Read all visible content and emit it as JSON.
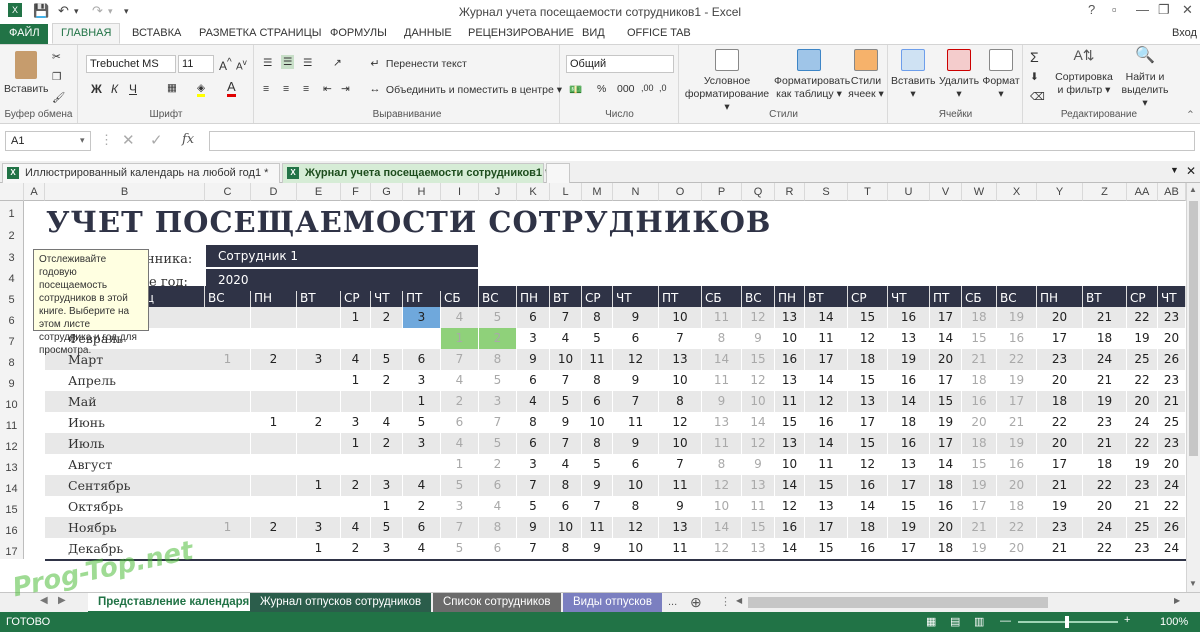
{
  "window": {
    "title": "Журнал учета посещаемости сотрудников1 - Excel",
    "help": "?",
    "user": "Вход"
  },
  "tabs": [
    "ФАЙЛ",
    "ГЛАВНАЯ",
    "ВСТАВКА",
    "РАЗМЕТКА СТРАНИЦЫ",
    "ФОРМУЛЫ",
    "ДАННЫЕ",
    "РЕЦЕНЗИРОВАНИЕ",
    "ВИД",
    "OFFICE TAB"
  ],
  "ribbon": {
    "clipboard": {
      "paste": "Вставить",
      "label": "Буфер обмена"
    },
    "font": {
      "name": "Trebuchet MS",
      "size": "11",
      "bold": "Ж",
      "italic": "К",
      "underline": "Ч",
      "label": "Шрифт"
    },
    "align": {
      "wrap": "Перенести текст",
      "merge": "Объединить и поместить в центре",
      "label": "Выравнивание"
    },
    "number": {
      "format": "Общий",
      "label": "Число"
    },
    "styles": {
      "cond": "Условное форматирование",
      "table": "Форматировать как таблицу",
      "cell": "Стили ячеек",
      "label": "Стили"
    },
    "cells": {
      "insert": "Вставить",
      "delete": "Удалить",
      "format": "Формат",
      "label": "Ячейки"
    },
    "edit": {
      "sort": "Сортировка и фильтр",
      "find": "Найти и выделить",
      "label": "Редактирование"
    }
  },
  "formula_bar": {
    "cell": "A1",
    "fx": "fx",
    "content": ""
  },
  "doc_tabs": [
    "Иллюстрированный календарь на любой год1 *",
    "Журнал учета посещаемости сотрудников1 *"
  ],
  "columns": [
    "A",
    "B",
    "C",
    "D",
    "E",
    "F",
    "G",
    "H",
    "I",
    "J",
    "K",
    "L",
    "M",
    "N",
    "O",
    "P",
    "Q",
    "R",
    "S",
    "T",
    "U",
    "V",
    "W",
    "X",
    "Y",
    "Z",
    "AA",
    "AB"
  ],
  "rows": [
    "1",
    "2",
    "3",
    "4",
    "5",
    "6",
    "7",
    "8",
    "9",
    "10",
    "11",
    "12",
    "13",
    "14",
    "15",
    "16",
    "17"
  ],
  "sheet": {
    "title": "УЧЕТ ПОСЕЩАЕМОСТИ СОТРУДНИКОВ",
    "employee_label": "нника:",
    "employee": "Сотрудник 1",
    "year_label": "е год:",
    "year": "2020",
    "month_header": "ц",
    "day_headers": [
      "ВС",
      "ПН",
      "ВТ",
      "СР",
      "ЧТ",
      "ПТ",
      "СБ",
      "ВС",
      "ПН",
      "ВТ",
      "СР",
      "ЧТ",
      "ПТ",
      "СБ",
      "ВС",
      "ПН",
      "ВТ",
      "СР",
      "ЧТ",
      "ПТ",
      "СБ",
      "ВС",
      "ПН",
      "ВТ",
      "СР",
      "ЧТ"
    ],
    "months": [
      "Январь",
      "Февраль",
      "Март",
      "Апрель",
      "Май",
      "Июнь",
      "Июль",
      "Август",
      "Сентябрь",
      "Октябрь",
      "Ноябрь",
      "Декабрь"
    ],
    "month_starts": [
      3,
      6,
      0,
      3,
      5,
      1,
      3,
      6,
      2,
      4,
      0,
      2
    ],
    "tooltip": "Отслеживайте годовую посещаемость сотрудников в этой книге. Выберите на этом листе сотрудника и год для просмотра.",
    "highlight": {
      "selected_blue": "#6fa8dc",
      "selected_green": "#8fd17a"
    }
  },
  "sheet_tabs": [
    "Представление календаря",
    "Журнал отпусков сотрудников",
    "Список сотрудников",
    "Виды отпусков"
  ],
  "sheet_tab_more": "...",
  "status": {
    "ready": "ГОТОВО",
    "zoom": "100%"
  },
  "watermark": "Prog-Top.net"
}
